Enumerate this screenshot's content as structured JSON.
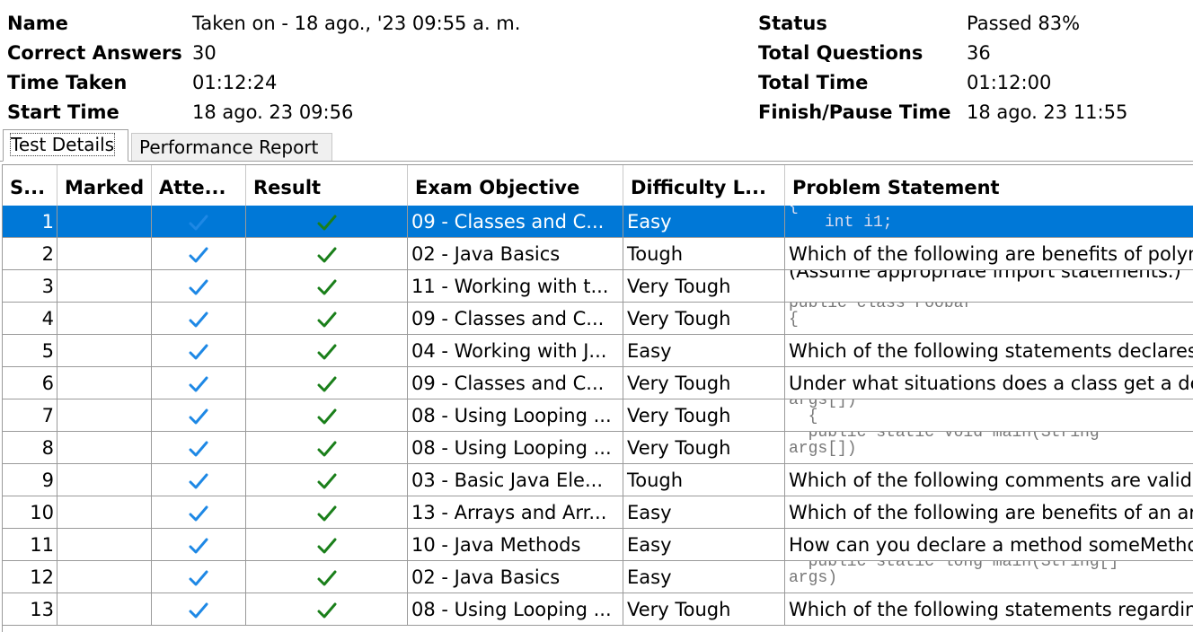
{
  "summary": {
    "name_label": "Name",
    "name_value": "Taken on - 18 ago., '23 09:55 a. m.",
    "correct_label": "Correct Answers",
    "correct_value": "30",
    "time_taken_label": "Time Taken",
    "time_taken_value": "01:12:24",
    "start_label": "Start Time",
    "start_value": "18 ago. 23 09:56",
    "status_label": "Status",
    "status_value": "Passed 83%",
    "total_q_label": "Total Questions",
    "total_q_value": "36",
    "total_time_label": "Total Time",
    "total_time_value": "01:12:00",
    "finish_label": "Finish/Pause Time",
    "finish_value": "18 ago. 23 11:55"
  },
  "tabs": [
    {
      "label": "Test Details",
      "active": true
    },
    {
      "label": "Performance Report",
      "active": false
    }
  ],
  "columns": [
    "S...",
    "Marked",
    "Atte...",
    "Result",
    "Exam Objective",
    "Difficulty L...",
    "Problem Statement"
  ],
  "colors": {
    "selected_row": "#0078d7",
    "attempted_check": "#1e88e5",
    "result_check": "#1a7f1a"
  },
  "rows": [
    {
      "sno": "1",
      "objective": "09 - Classes and C...",
      "difficulty": "Easy",
      "problem_top": "{",
      "problem": "int i1;",
      "problem_is_code": true,
      "selected": true
    },
    {
      "sno": "2",
      "objective": "02 - Java Basics",
      "difficulty": "Tough",
      "problem": "Which of the following are benefits of polym",
      "problem_is_code": false
    },
    {
      "sno": "3",
      "objective": "11 - Working with t...",
      "difficulty": "Very Tough",
      "problem": "(Assume appropriate import statements.)",
      "problem_is_code": false,
      "shift_up": true
    },
    {
      "sno": "4",
      "objective": "09 - Classes and C...",
      "difficulty": "Very Tough",
      "problem_top": "public class Foobar",
      "problem": "{",
      "problem_is_code": true
    },
    {
      "sno": "5",
      "objective": "04 - Working with J...",
      "difficulty": "Easy",
      "problem": "Which of the following statements declares",
      "problem_is_code": false
    },
    {
      "sno": "6",
      "objective": "09 - Classes and C...",
      "difficulty": "Very Tough",
      "problem": "Under what situations does a class get a de",
      "problem_is_code": false
    },
    {
      "sno": "7",
      "objective": "08 - Using Looping ...",
      "difficulty": "Very Tough",
      "problem_top": "args[])",
      "problem": "  {",
      "problem_is_code": true
    },
    {
      "sno": "8",
      "objective": "08 - Using Looping ...",
      "difficulty": "Very Tough",
      "problem_top": "  public static void main(String",
      "problem": "args[])",
      "problem_is_code": true
    },
    {
      "sno": "9",
      "objective": "03 - Basic Java Ele...",
      "difficulty": "Tough",
      "problem": "Which of the following comments are valid",
      "problem_is_code": false
    },
    {
      "sno": "10",
      "objective": "13 - Arrays and Arr...",
      "difficulty": "Easy",
      "problem": "Which of the following are benefits of an ar",
      "problem_is_code": false
    },
    {
      "sno": "11",
      "objective": "10 - Java Methods",
      "difficulty": "Easy",
      "problem": "How can you declare a method someMetho",
      "problem_is_code": false
    },
    {
      "sno": "12",
      "objective": "02 - Java Basics",
      "difficulty": "Easy",
      "problem_top": "  public static long main(String[]",
      "problem": "args)",
      "problem_is_code": true
    },
    {
      "sno": "13",
      "objective": "08 - Using Looping ...",
      "difficulty": "Very Tough",
      "problem": "Which of the following statements regardin",
      "problem_is_code": false
    }
  ]
}
